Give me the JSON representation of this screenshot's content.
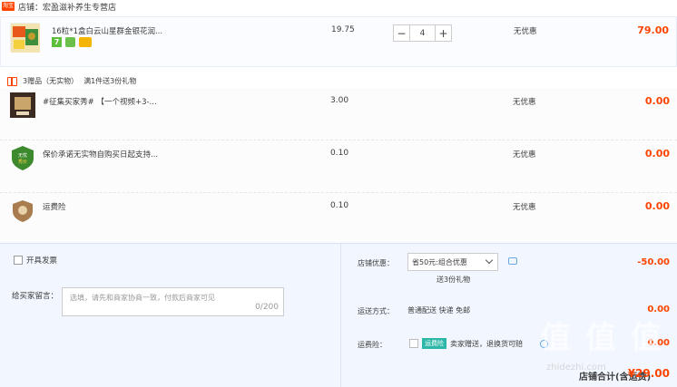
{
  "store": {
    "tag": "淘宝",
    "label": "店铺：宏盈滋补养生专营店"
  },
  "main_item": {
    "title": "16粒*1盒白云山星群金银花润...",
    "price": "19.75",
    "quantity": "4",
    "minus": "−",
    "plus": "+",
    "promo": "无优惠",
    "total": "79.00",
    "badge_seven": "7"
  },
  "gifts_header": {
    "count_label": "3赠品（无实物）",
    "rule": "满1件送3份礼物"
  },
  "gifts": [
    {
      "title": "#征集买家秀# 【一个视频+3-...",
      "price": "3.00",
      "promo": "无优惠",
      "total": "0.00"
    },
    {
      "title": "保价承诺无实物自购买日起支持...",
      "price": "0.10",
      "promo": "无优惠",
      "total": "0.00"
    },
    {
      "title": "运费险",
      "price": "0.10",
      "promo": "无优惠",
      "total": "0.00"
    }
  ],
  "footer": {
    "invoice_label": "开具发票",
    "message_label": "给买家留言：",
    "message_placeholder": "选填，请先和商家协商一致，付款后商家可见",
    "message_counter": "0/200",
    "store_discount_label": "店铺优惠：",
    "store_discount_select": "省50元:组合优惠",
    "store_discount_value": "-50.00",
    "gift_note": "送3份礼物",
    "shipping_label": "运送方式：",
    "shipping_value": "普通配送 快递 免邮",
    "shipping_cost": "0.00",
    "insurance_label": "运费险：",
    "insurance_tag": "运费险",
    "insurance_text": "卖家赠送，退换货可赔",
    "insurance_cost": "0.00",
    "grand_label": "店铺合计(含运费)",
    "grand_value": "¥29.00"
  },
  "watermark": {
    "main": "值 值 值",
    "sub": "zhidezhi.com"
  },
  "colors": {
    "accent": "#ff4400",
    "footer_bg": "#f2f7ff",
    "insurance": "#2db7a8"
  }
}
